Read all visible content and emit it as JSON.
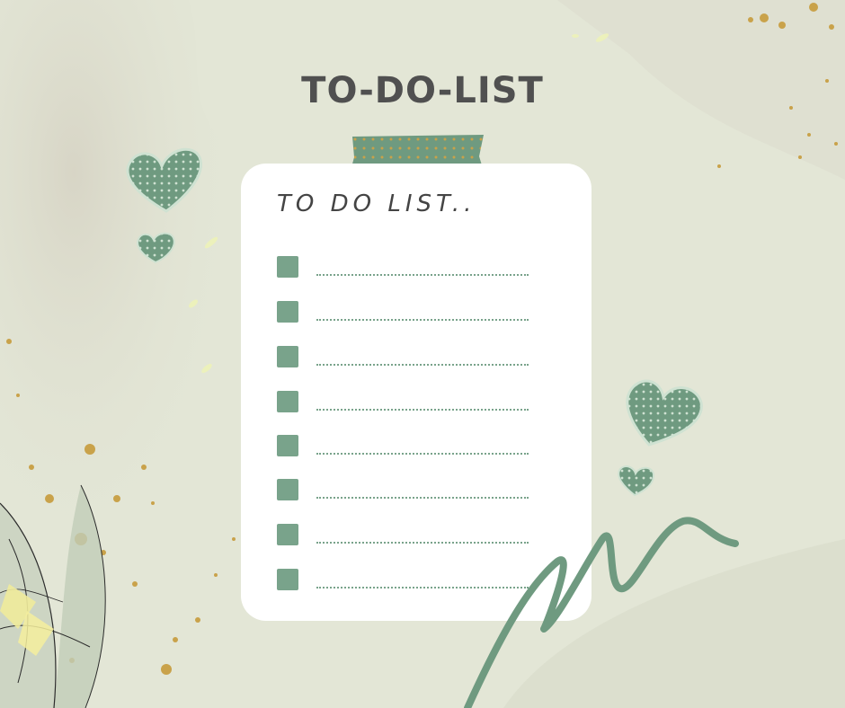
{
  "page": {
    "title": "TO-DO-LIST",
    "card_heading": "TO DO LIST..",
    "items": [
      {
        "checked": false,
        "text": ""
      },
      {
        "checked": false,
        "text": ""
      },
      {
        "checked": false,
        "text": ""
      },
      {
        "checked": false,
        "text": ""
      },
      {
        "checked": false,
        "text": ""
      },
      {
        "checked": false,
        "text": ""
      },
      {
        "checked": false,
        "text": ""
      },
      {
        "checked": false,
        "text": ""
      }
    ]
  },
  "colors": {
    "background": "#e3e6d6",
    "accent_green": "#79a38b",
    "gold": "#c9a24a",
    "title_text": "#505050"
  },
  "decorations": [
    "polka-dot-heart-icon",
    "washi-tape",
    "gold-splatter",
    "leaf-illustration",
    "scribble-stroke"
  ]
}
